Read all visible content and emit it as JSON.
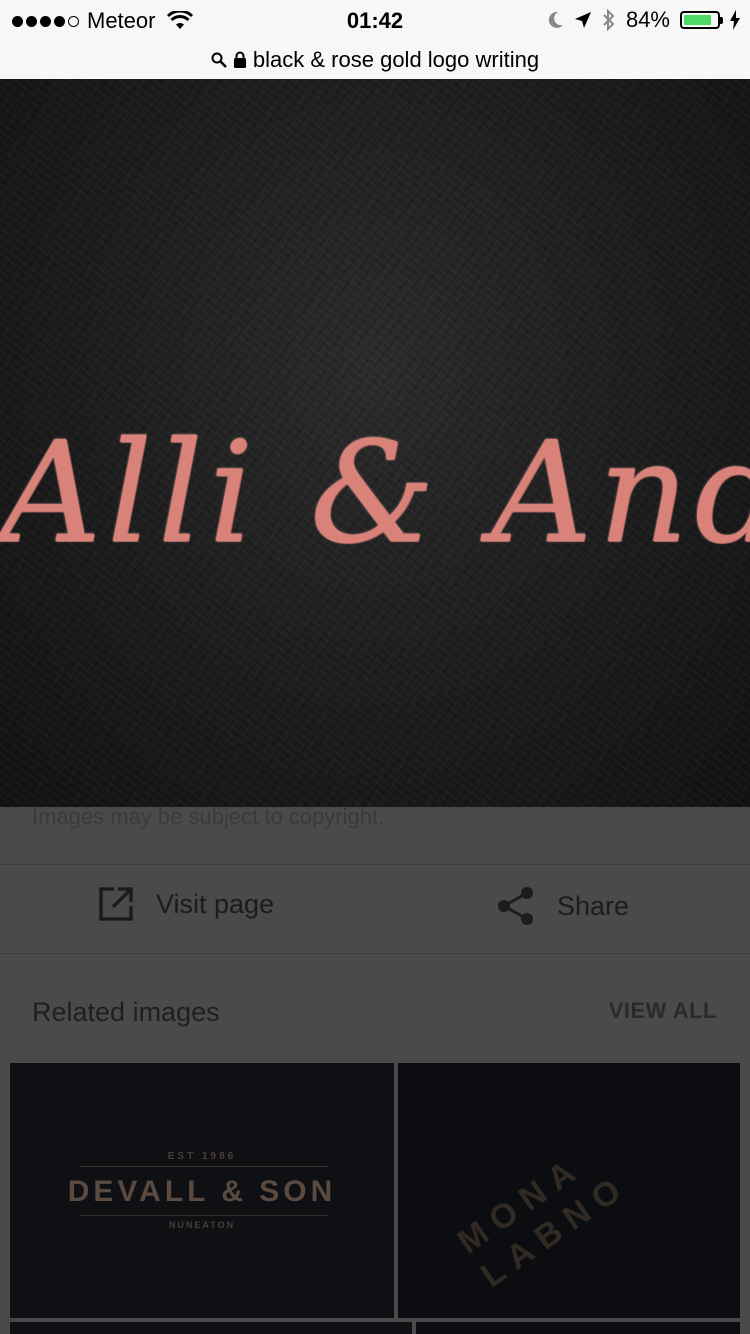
{
  "status_bar": {
    "carrier": "Meteor",
    "time": "01:42",
    "battery_percent_text": "84%",
    "battery_level": 0.84
  },
  "url_bar": {
    "text": "black & rose gold logo writing"
  },
  "hero_image": {
    "script_text": "Alli & Andr"
  },
  "copyright_notice": "Images may be subject to copyright.",
  "actions": {
    "visit_label": "Visit page",
    "share_label": "Share"
  },
  "related": {
    "title": "Related images",
    "view_all": "VIEW ALL",
    "thumbs": [
      {
        "est": "EST 1986",
        "name": "DEVALL & SON",
        "place": "NUNEATON"
      },
      {
        "line1": "MONA",
        "line2": "LABNO"
      }
    ]
  },
  "colors": {
    "battery_green": "#4cd964",
    "rose_gold": "#d9827a"
  }
}
